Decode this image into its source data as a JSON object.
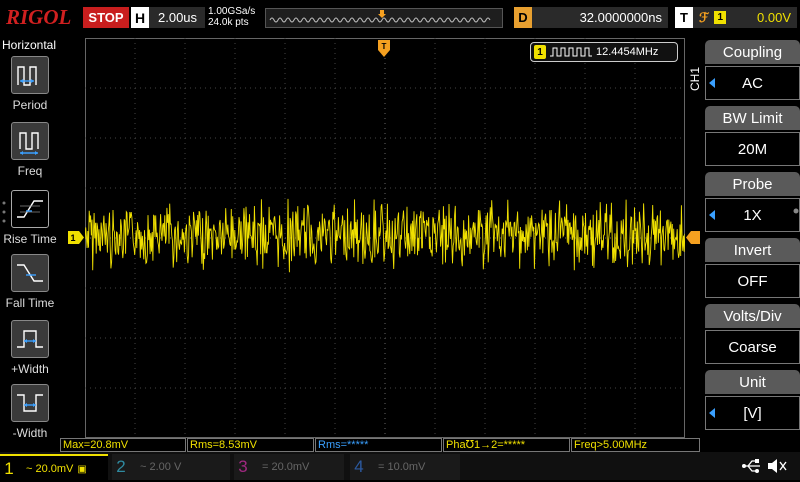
{
  "header": {
    "logo": "RIGOL",
    "run_status": "STOP",
    "horizontal": {
      "letter": "H",
      "timebase": "2.00us"
    },
    "sample_rate": "1.00GSa/s",
    "mem_depth": "24.0k pts",
    "delay": {
      "letter": "D",
      "value": "32.0000000ns"
    },
    "trigger": {
      "letter": "T",
      "source": "1",
      "level": "0.00V"
    }
  },
  "left_menu": {
    "title": "Horizontal",
    "items": [
      {
        "label": "Period",
        "icon": "period-icon"
      },
      {
        "label": "Freq",
        "icon": "freq-icon"
      },
      {
        "label": "Rise Time",
        "icon": "rise-time-icon"
      },
      {
        "label": "Fall Time",
        "icon": "fall-time-icon"
      },
      {
        "label": "+Width",
        "icon": "positive-width-icon"
      },
      {
        "label": "-Width",
        "icon": "negative-width-icon"
      }
    ]
  },
  "waveform": {
    "channel_marker": "1",
    "frequency_counter": {
      "channel": "1",
      "value": "12.4454MHz"
    },
    "color": "#f0e000"
  },
  "right_menu": {
    "channel_label": "CH1",
    "items": [
      {
        "title": "Coupling",
        "value": "AC",
        "has_arrow": true
      },
      {
        "title": "BW Limit",
        "value": "20M",
        "has_arrow": false
      },
      {
        "title": "Probe",
        "value": "1X",
        "has_arrow": true
      },
      {
        "title": "Invert",
        "value": "OFF",
        "has_arrow": false
      },
      {
        "title": "Volts/Div",
        "value": "Coarse",
        "has_arrow": false
      },
      {
        "title": "Unit",
        "value": "[V]",
        "has_arrow": true
      }
    ]
  },
  "measurements": [
    {
      "text": "Max=20.8mV"
    },
    {
      "text": "Rms=8.53mV"
    },
    {
      "text": "Rms=*****"
    },
    {
      "text": "Pha℧1→2=*****"
    },
    {
      "text": "Freq>5.00MHz"
    }
  ],
  "channels": [
    {
      "num": "1",
      "scale": "~ 20.0mV",
      "active": true
    },
    {
      "num": "2",
      "scale": "~  2.00 V",
      "active": false
    },
    {
      "num": "3",
      "scale": "=   20.0mV",
      "active": false
    },
    {
      "num": "4",
      "scale": "=   10.0mV",
      "active": false
    }
  ],
  "colors": {
    "ch1": "#f0e000",
    "run_stop": "#c81e1e",
    "menu_arrow": "#3aa0ff",
    "trigger": "#f5a020"
  }
}
